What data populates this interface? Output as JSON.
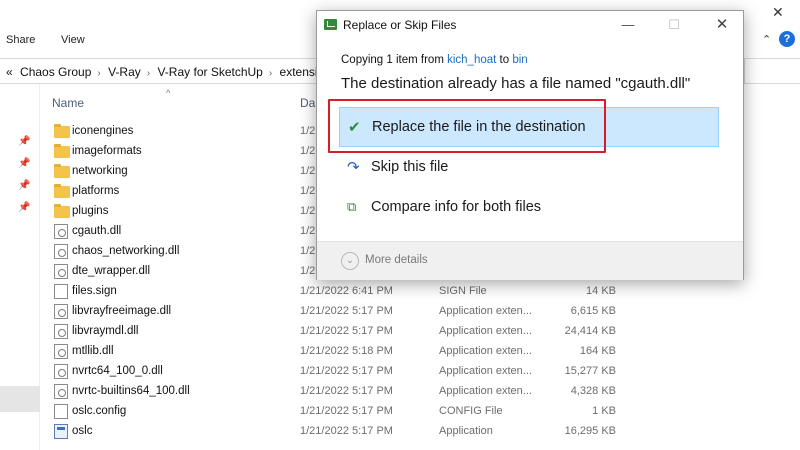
{
  "explorer": {
    "ribbon_tabs": [
      "Share",
      "View"
    ],
    "address": {
      "back_glyph": "«",
      "crumbs": [
        "Chaos Group",
        "V-Ray",
        "V-Ray for SketchUp",
        "extensi"
      ]
    },
    "columns": {
      "name": "Name",
      "date": "Da"
    },
    "files": [
      {
        "name": "iconengines",
        "date": "1/2",
        "type": "",
        "size": "",
        "icon": "folder-icon"
      },
      {
        "name": "imageformats",
        "date": "1/2",
        "type": "",
        "size": "",
        "icon": "folder-icon"
      },
      {
        "name": "networking",
        "date": "1/2",
        "type": "",
        "size": "",
        "icon": "folder-icon"
      },
      {
        "name": "platforms",
        "date": "1/2",
        "type": "",
        "size": "",
        "icon": "folder-icon"
      },
      {
        "name": "plugins",
        "date": "1/2",
        "type": "",
        "size": "",
        "icon": "folder-icon"
      },
      {
        "name": "cgauth.dll",
        "date": "1/2",
        "type": "",
        "size": "",
        "icon": "dll-icon"
      },
      {
        "name": "chaos_networking.dll",
        "date": "1/2",
        "type": "",
        "size": "",
        "icon": "dll-icon"
      },
      {
        "name": "dte_wrapper.dll",
        "date": "1/2",
        "type": "",
        "size": "",
        "icon": "dll-icon"
      },
      {
        "name": "files.sign",
        "date": "1/21/2022 6:41 PM",
        "type": "SIGN File",
        "size": "14 KB",
        "icon": "document-icon"
      },
      {
        "name": "libvrayfreeimage.dll",
        "date": "1/21/2022 5:17 PM",
        "type": "Application exten...",
        "size": "6,615 KB",
        "icon": "dll-icon"
      },
      {
        "name": "libvraymdl.dll",
        "date": "1/21/2022 5:17 PM",
        "type": "Application exten...",
        "size": "24,414 KB",
        "icon": "dll-icon"
      },
      {
        "name": "mtllib.dll",
        "date": "1/21/2022 5:18 PM",
        "type": "Application exten...",
        "size": "164 KB",
        "icon": "dll-icon"
      },
      {
        "name": "nvrtc64_100_0.dll",
        "date": "1/21/2022 5:17 PM",
        "type": "Application exten...",
        "size": "15,277 KB",
        "icon": "dll-icon"
      },
      {
        "name": "nvrtc-builtins64_100.dll",
        "date": "1/21/2022 5:17 PM",
        "type": "Application exten...",
        "size": "4,328 KB",
        "icon": "dll-icon"
      },
      {
        "name": "oslc.config",
        "date": "1/21/2022 5:17 PM",
        "type": "CONFIG File",
        "size": "1 KB",
        "icon": "document-icon"
      },
      {
        "name": "oslc",
        "date": "1/21/2022 5:17 PM",
        "type": "Application",
        "size": "16,295 KB",
        "icon": "application-icon"
      }
    ]
  },
  "dialog": {
    "title": "Replace or Skip Files",
    "copy_prefix": "Copying 1 item from",
    "source": "kich_hoat",
    "to_word": "to",
    "destination": "bin",
    "message": "The destination already has a file named \"cgauth.dll\"",
    "options": {
      "replace": "Replace the file in the destination",
      "skip": "Skip this file",
      "compare": "Compare info for both files"
    },
    "more_details": "More details"
  },
  "colors": {
    "selected_option_bg": "#cce8ff",
    "highlight_box": "#d41f27",
    "link": "#1b6ec2"
  }
}
